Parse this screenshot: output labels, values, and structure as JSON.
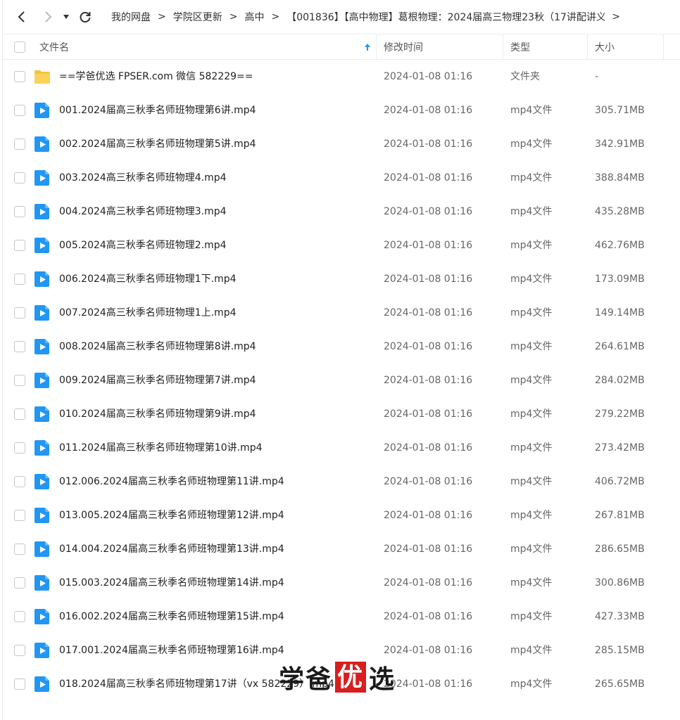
{
  "toolbar": {
    "breadcrumbs": [
      "我的网盘",
      "学院区更新",
      "高中",
      "【001836】【高中物理】葛根物理：2024届高三物理23秋（17讲配讲义..."
    ]
  },
  "header": {
    "name_label": "文件名",
    "mtime_label": "修改时间",
    "type_label": "类型",
    "size_label": "大小"
  },
  "files": [
    {
      "name": "==学爸优选 FPSER.com 微信 582229==",
      "mtime": "2024-01-08 01:16",
      "type": "文件夹",
      "size": "-",
      "icon": "folder-icon"
    },
    {
      "name": "001.2024届高三秋季名师班物理第6讲.mp4",
      "mtime": "2024-01-08 01:16",
      "type": "mp4文件",
      "size": "305.71MB",
      "icon": "video-file-icon"
    },
    {
      "name": "002.2024届高三秋季名师班物理第5讲.mp4",
      "mtime": "2024-01-08 01:16",
      "type": "mp4文件",
      "size": "342.91MB",
      "icon": "video-file-icon"
    },
    {
      "name": "003.2024高三秋季名师班物理4.mp4",
      "mtime": "2024-01-08 01:16",
      "type": "mp4文件",
      "size": "388.84MB",
      "icon": "video-file-icon"
    },
    {
      "name": "004.2024高三秋季名师班物理3.mp4",
      "mtime": "2024-01-08 01:16",
      "type": "mp4文件",
      "size": "435.28MB",
      "icon": "video-file-icon"
    },
    {
      "name": "005.2024高三秋季名师班物理2.mp4",
      "mtime": "2024-01-08 01:16",
      "type": "mp4文件",
      "size": "462.76MB",
      "icon": "video-file-icon"
    },
    {
      "name": "006.2024高三秋季名师班物理1下.mp4",
      "mtime": "2024-01-08 01:16",
      "type": "mp4文件",
      "size": "173.09MB",
      "icon": "video-file-icon"
    },
    {
      "name": "007.2024高三秋季名师班物理1上.mp4",
      "mtime": "2024-01-08 01:16",
      "type": "mp4文件",
      "size": "149.14MB",
      "icon": "video-file-icon"
    },
    {
      "name": "008.2024届高三秋季名师班物理第8讲.mp4",
      "mtime": "2024-01-08 01:16",
      "type": "mp4文件",
      "size": "264.61MB",
      "icon": "video-file-icon"
    },
    {
      "name": "009.2024届高三秋季名师班物理第7讲.mp4",
      "mtime": "2024-01-08 01:16",
      "type": "mp4文件",
      "size": "284.02MB",
      "icon": "video-file-icon"
    },
    {
      "name": "010.2024届高三秋季名师班物理第9讲.mp4",
      "mtime": "2024-01-08 01:16",
      "type": "mp4文件",
      "size": "279.22MB",
      "icon": "video-file-icon"
    },
    {
      "name": "011.2024届高三秋季名师班物理第10讲.mp4",
      "mtime": "2024-01-08 01:16",
      "type": "mp4文件",
      "size": "273.42MB",
      "icon": "video-file-icon"
    },
    {
      "name": "012.006.2024届高三秋季名师班物理第11讲.mp4",
      "mtime": "2024-01-08 01:16",
      "type": "mp4文件",
      "size": "406.72MB",
      "icon": "video-file-icon"
    },
    {
      "name": "013.005.2024届高三秋季名师班物理第12讲.mp4",
      "mtime": "2024-01-08 01:16",
      "type": "mp4文件",
      "size": "267.81MB",
      "icon": "video-file-icon"
    },
    {
      "name": "014.004.2024届高三秋季名师班物理第13讲.mp4",
      "mtime": "2024-01-08 01:16",
      "type": "mp4文件",
      "size": "286.65MB",
      "icon": "video-file-icon"
    },
    {
      "name": "015.003.2024届高三秋季名师班物理第14讲.mp4",
      "mtime": "2024-01-08 01:16",
      "type": "mp4文件",
      "size": "300.86MB",
      "icon": "video-file-icon"
    },
    {
      "name": "016.002.2024届高三秋季名师班物理第15讲.mp4",
      "mtime": "2024-01-08 01:16",
      "type": "mp4文件",
      "size": "427.33MB",
      "icon": "video-file-icon"
    },
    {
      "name": "017.001.2024届高三秋季名师班物理第16讲.mp4",
      "mtime": "2024-01-08 01:16",
      "type": "mp4文件",
      "size": "285.15MB",
      "icon": "video-file-icon"
    },
    {
      "name": "018.2024届高三秋季名师班物理第17讲（vx 582229）.mp4",
      "mtime": "2024-01-08 01:16",
      "type": "mp4文件",
      "size": "265.65MB",
      "icon": "video-file-icon"
    }
  ],
  "watermark": {
    "part1": "学爸",
    "seal": "优",
    "part2": "选"
  },
  "colors": {
    "accent": "#2196f3",
    "folder": "#f7c23c",
    "seal": "#d81e1e"
  }
}
